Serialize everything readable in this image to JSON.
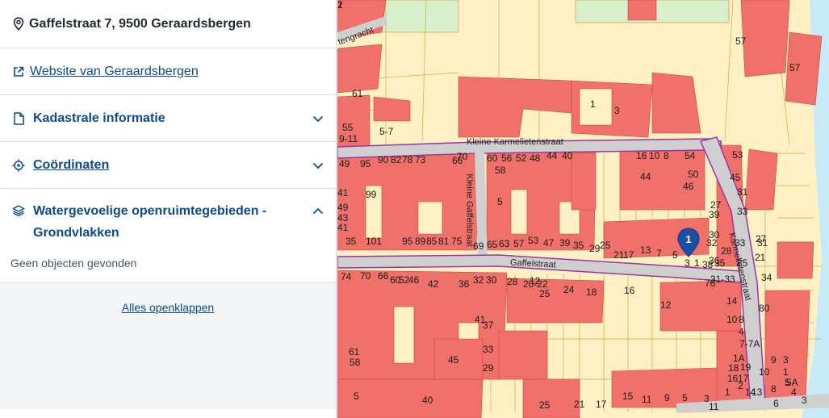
{
  "sidebar": {
    "address": "Gaffelstraat 7, 9500 Geraardsbergen",
    "website_link": "Website van Geraardsbergen",
    "sections": [
      {
        "label": "Kadastrale informatie",
        "icon": "document-icon"
      },
      {
        "label": "Coördinaten",
        "icon": "target-icon"
      },
      {
        "label": "Watergevoelige openruimtegebieden - Grondvlakken",
        "icon": "layers-icon"
      }
    ],
    "no_objects": "Geen objecten gevonden",
    "expand_all": "Alles openklappen"
  },
  "map": {
    "colors": {
      "parcel": "#fff1c4",
      "building": "#f0716a",
      "street": "#cfcfcf",
      "water": "#c6eaf7",
      "green": "#d8efcc",
      "boundary": "#a033a0"
    },
    "marker": "1",
    "streets": [
      "Kleine Karmelietenstraat",
      "Kleine Gaffelstraat",
      "Gaffelstraat",
      "Karmelietenstraat",
      "tengracht"
    ],
    "labels": [
      "57",
      "57",
      "3",
      "1",
      "61",
      "55",
      "9-11",
      "5-7",
      "53",
      "16",
      "10",
      "8",
      "54",
      "50",
      "70",
      "60",
      "56",
      "52",
      "48",
      "44",
      "40",
      "49",
      "95",
      "90",
      "82",
      "78",
      "73",
      "66",
      "58",
      "44",
      "46",
      "45",
      "41",
      "99",
      "49",
      "5",
      "31",
      "27",
      "33",
      "43",
      "41",
      "39",
      "35",
      "33",
      "31",
      "25",
      "101",
      "95",
      "89",
      "85",
      "81",
      "75",
      "69",
      "65",
      "63",
      "57",
      "53",
      "47",
      "39",
      "35",
      "29",
      "25",
      "21",
      "17",
      "13",
      "7",
      "5",
      "3",
      "1",
      "38",
      "36",
      "32",
      "30",
      "28",
      "35",
      "31-33",
      "27",
      "21",
      "34",
      "80",
      "76",
      "74",
      "70",
      "66",
      "60",
      "52",
      "46",
      "42",
      "36",
      "32",
      "30",
      "28",
      "20-22",
      "12",
      "25",
      "24",
      "18",
      "16",
      "14",
      "12",
      "10",
      "8",
      "4",
      "7-7A",
      "1A",
      "3",
      "5A",
      "5",
      "1",
      "61",
      "58",
      "40",
      "45",
      "41",
      "37",
      "33",
      "29",
      "25",
      "21",
      "17",
      "15",
      "11",
      "9",
      "5",
      "3",
      "1",
      "2",
      "19",
      "18",
      "17",
      "16",
      "14",
      "13",
      "11",
      "10",
      "9",
      "8",
      "6",
      "5",
      "4",
      "3",
      "2",
      "1"
    ]
  }
}
